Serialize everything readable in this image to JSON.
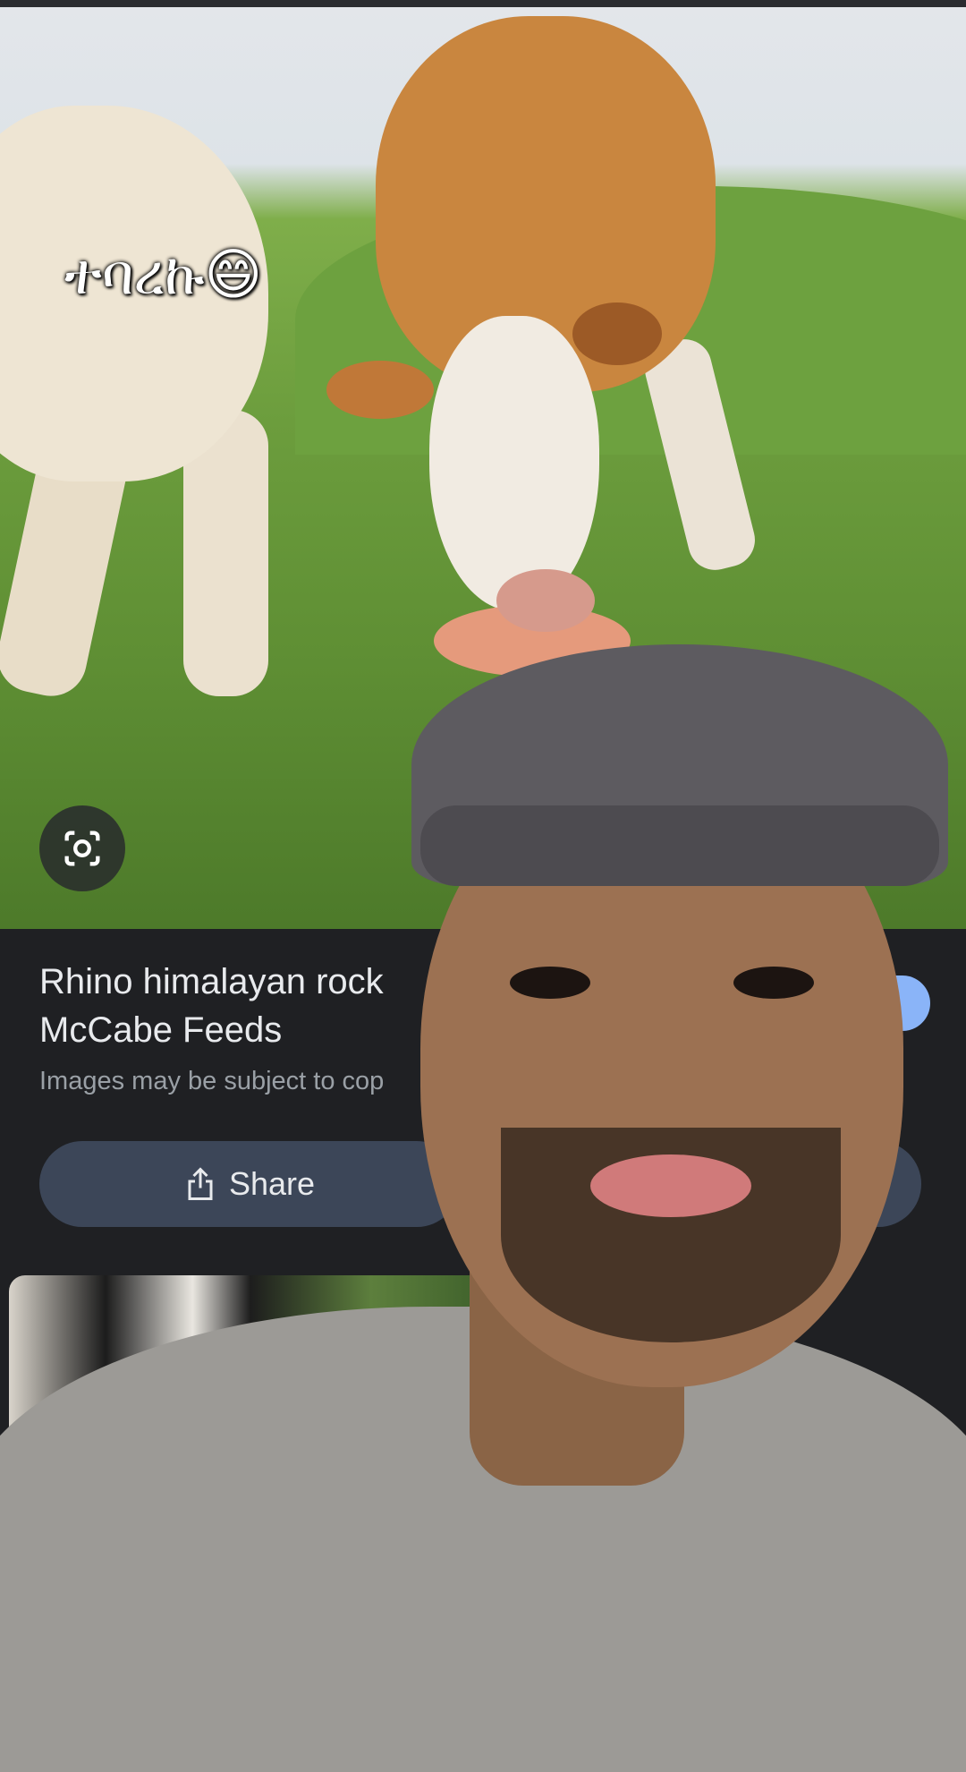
{
  "overlay": {
    "caption": "ተባረኩ😄"
  },
  "result": {
    "title_line1": "Rhino himalayan rock",
    "title_line2": "McCabe Feeds",
    "copyright": "Images may be subject to cop",
    "share_label": "Share"
  },
  "icons": {
    "lens": "lens-camera-icon",
    "share": "share-icon"
  },
  "colors": {
    "panel_bg": "#1f2023",
    "button_bg": "#3c4658",
    "accent_blue": "#8ab4f8"
  }
}
